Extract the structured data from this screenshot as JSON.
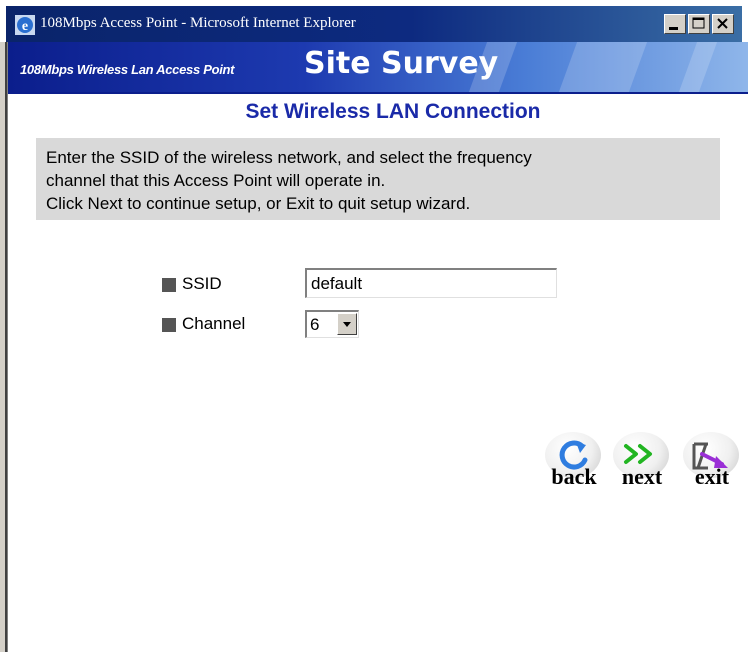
{
  "window": {
    "title": "108Mbps Access Point - Microsoft Internet Explorer"
  },
  "banner": {
    "product_tagline": "108Mbps Wireless Lan Access Point",
    "section_title": "Site Survey"
  },
  "page": {
    "heading": "Set Wireless LAN Connection",
    "instructions": [
      "Enter the SSID of the wireless network, and select the frequency",
      "channel that this Access Point will operate in.",
      "Click Next to continue setup, or Exit to quit setup wizard."
    ]
  },
  "form": {
    "ssid_label": "SSID",
    "ssid_value": "default",
    "channel_label": "Channel",
    "channel_value": "6"
  },
  "nav": {
    "back_label": "back",
    "next_label": "next",
    "exit_label": "exit"
  },
  "colors": {
    "titlebar": "#0a246a",
    "heading": "#1a2aa8",
    "instructions_bg": "#d9d9d9",
    "back_icon": "#2f7de0",
    "next_icon": "#22b522",
    "exit_icon": "#9a2fd6"
  }
}
